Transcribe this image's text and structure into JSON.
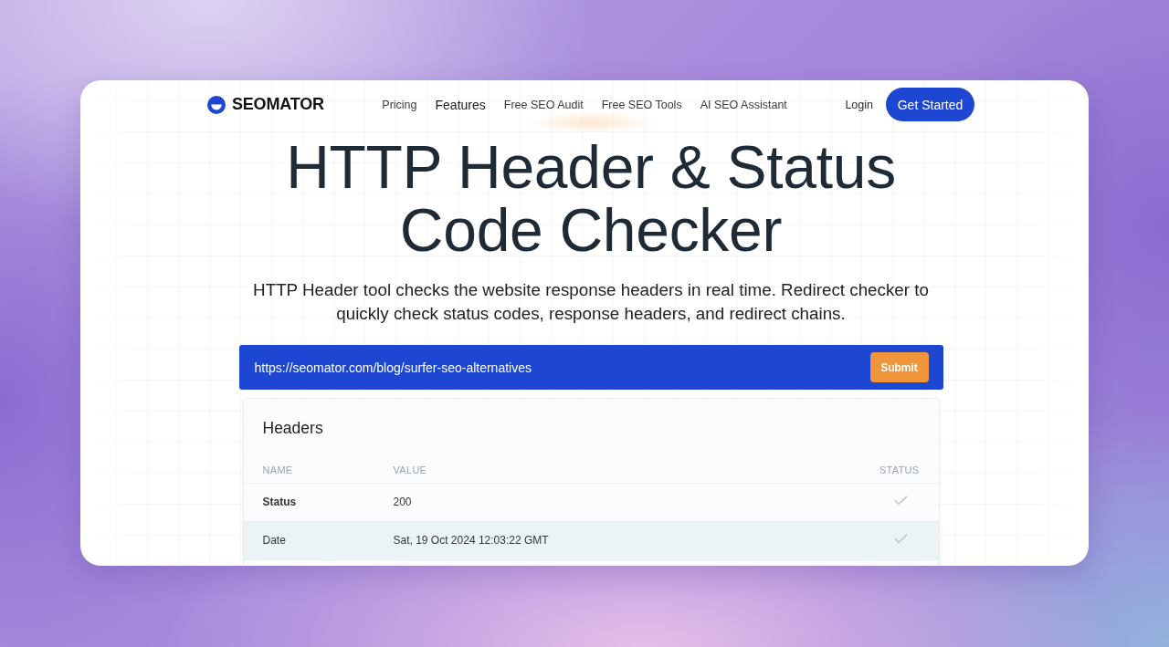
{
  "brand": {
    "name": "SEOMATOR"
  },
  "nav": {
    "links": [
      {
        "label": "Pricing",
        "selected": false
      },
      {
        "label": "Features",
        "selected": true
      },
      {
        "label": "Free SEO Audit",
        "selected": false
      },
      {
        "label": "Free SEO Tools",
        "selected": false
      },
      {
        "label": "AI SEO Assistant",
        "selected": false
      }
    ],
    "login": "Login",
    "cta": "Get Started"
  },
  "hero": {
    "title": "HTTP Header & Status Code Checker",
    "subtitle": "HTTP Header tool checks the website response headers in real time. Redirect checker to quickly check status codes, response headers, and redirect chains."
  },
  "url_form": {
    "value": "https://seomator.com/blog/surfer-seo-alternatives",
    "submit": "Submit"
  },
  "headers_table": {
    "title": "Headers",
    "columns": [
      "NAME",
      "VALUE",
      "STATUS"
    ],
    "rows": [
      {
        "name": "Status",
        "value": "200",
        "passed": true,
        "emphasized": true,
        "highlighted": false
      },
      {
        "name": "Date",
        "value": "Sat, 19 Oct 2024 12:03:22 GMT",
        "passed": true,
        "emphasized": false,
        "highlighted": true
      }
    ]
  }
}
